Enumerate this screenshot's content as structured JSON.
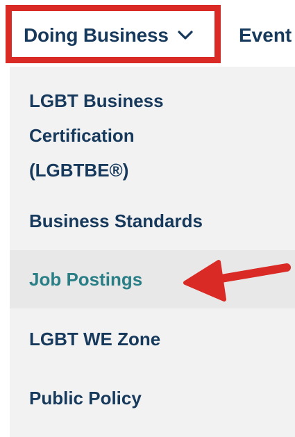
{
  "nav": {
    "doing_business_label": "Doing Business",
    "events_label": "Event"
  },
  "dropdown": {
    "items": [
      {
        "label": "LGBT Business Certification (LGBTBE®)"
      },
      {
        "label": "Business Standards"
      },
      {
        "label": "Job Postings",
        "highlighted": true
      },
      {
        "label": "LGBT WE Zone"
      },
      {
        "label": "Public Policy"
      }
    ]
  },
  "icons": {
    "doing_business_toggle": "chevron-down-icon",
    "annotation": "red-arrow-icon"
  },
  "colors": {
    "nav_text": "#173a5c",
    "menu_text": "#173a5c",
    "active_text": "#2a7f86",
    "annotation_red": "#d92a26",
    "panel_bg": "#f2f2f2",
    "active_bg": "#e8e8e8"
  }
}
